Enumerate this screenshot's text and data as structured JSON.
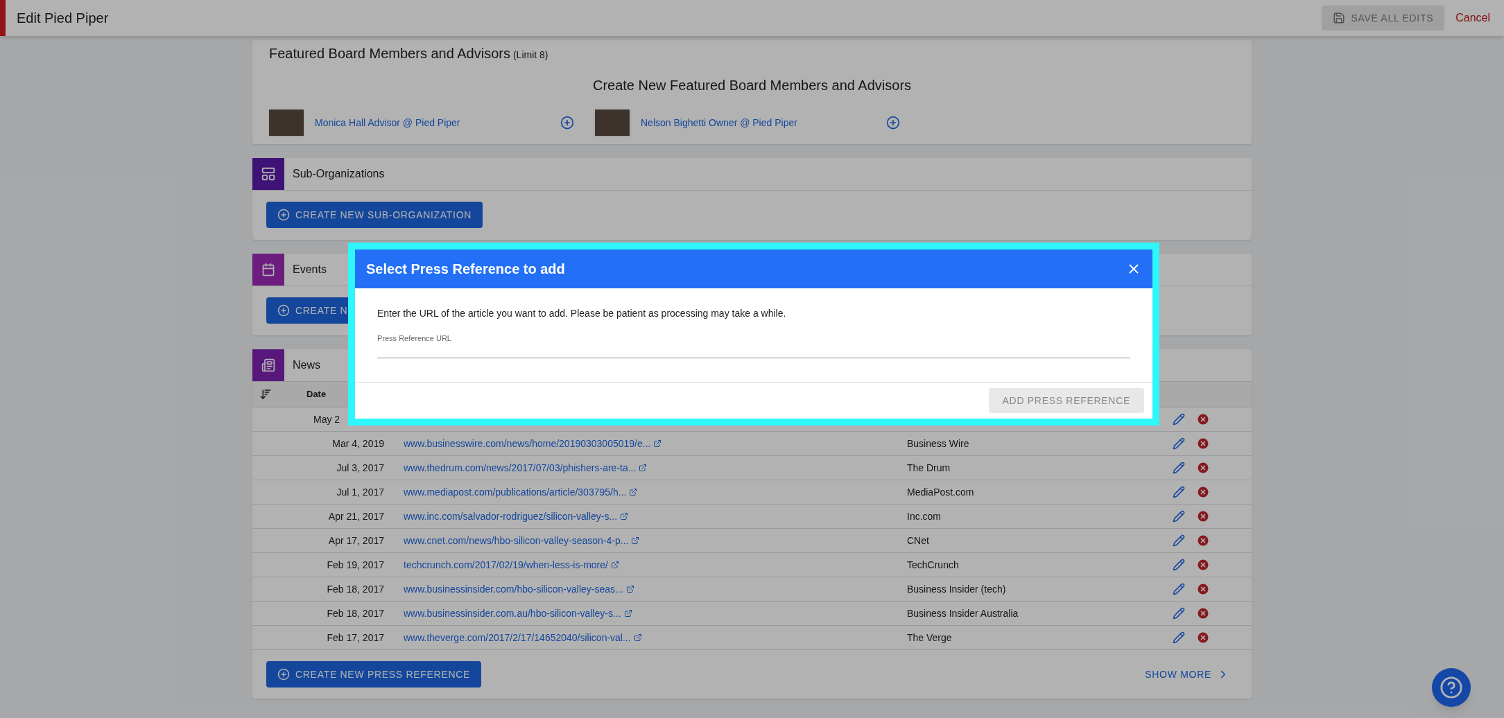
{
  "header": {
    "title": "Edit Pied Piper",
    "save_button": "SAVE ALL EDITS",
    "cancel": "Cancel"
  },
  "featured": {
    "title": "Featured Board Members and Advisors",
    "limit": "(Limit 8)",
    "subtitle": "Create New Featured Board Members and Advisors",
    "members": [
      {
        "label": "Monica Hall Advisor @ Pied Piper"
      },
      {
        "label": "Nelson Bighetti Owner @ Pied Piper"
      }
    ]
  },
  "sections": [
    {
      "kind": "suborg",
      "title": "Sub-Organizations",
      "button": "CREATE NEW SUB-ORGANIZATION"
    },
    {
      "kind": "events",
      "title": "Events",
      "button": "CREATE N"
    }
  ],
  "news": {
    "title": "News",
    "columns": [
      "Date"
    ],
    "rows": [
      {
        "date": "May 2"
      },
      {
        "date": "Mar 4, 2019",
        "url": "www.businesswire.com/news/home/20190303005019/e...",
        "source": "Business Wire"
      },
      {
        "date": "Jul 3, 2017",
        "url": "www.thedrum.com/news/2017/07/03/phishers-are-ta...",
        "source": "The Drum"
      },
      {
        "date": "Jul 1, 2017",
        "url": "www.mediapost.com/publications/article/303795/h...",
        "source": "MediaPost.com"
      },
      {
        "date": "Apr 21, 2017",
        "url": "www.inc.com/salvador-rodriguez/silicon-valley-s...",
        "source": "Inc.com"
      },
      {
        "date": "Apr 17, 2017",
        "url": "www.cnet.com/news/hbo-silicon-valley-season-4-p...",
        "source": "CNet"
      },
      {
        "date": "Feb 19, 2017",
        "url": "techcrunch.com/2017/02/19/when-less-is-more/",
        "source": "TechCrunch"
      },
      {
        "date": "Feb 18, 2017",
        "url": "www.businessinsider.com/hbo-silicon-valley-seas...",
        "source": "Business Insider (tech)"
      },
      {
        "date": "Feb 18, 2017",
        "url": "www.businessinsider.com.au/hbo-silicon-valley-s...",
        "source": "Business Insider Australia"
      },
      {
        "date": "Feb 17, 2017",
        "url": "www.theverge.com/2017/2/17/14652040/silicon-val...",
        "source": "The Verge"
      }
    ],
    "create_button": "CREATE NEW PRESS REFERENCE",
    "show_more": "SHOW MORE"
  },
  "dialog": {
    "title": "Select Press Reference to add",
    "message": "Enter the URL of the article you want to add. Please be patient as processing may take a while.",
    "field": {
      "label": "Press Reference URL"
    },
    "button": {
      "label": "ADD PRESS REFERENCE",
      "disabled": true
    }
  }
}
